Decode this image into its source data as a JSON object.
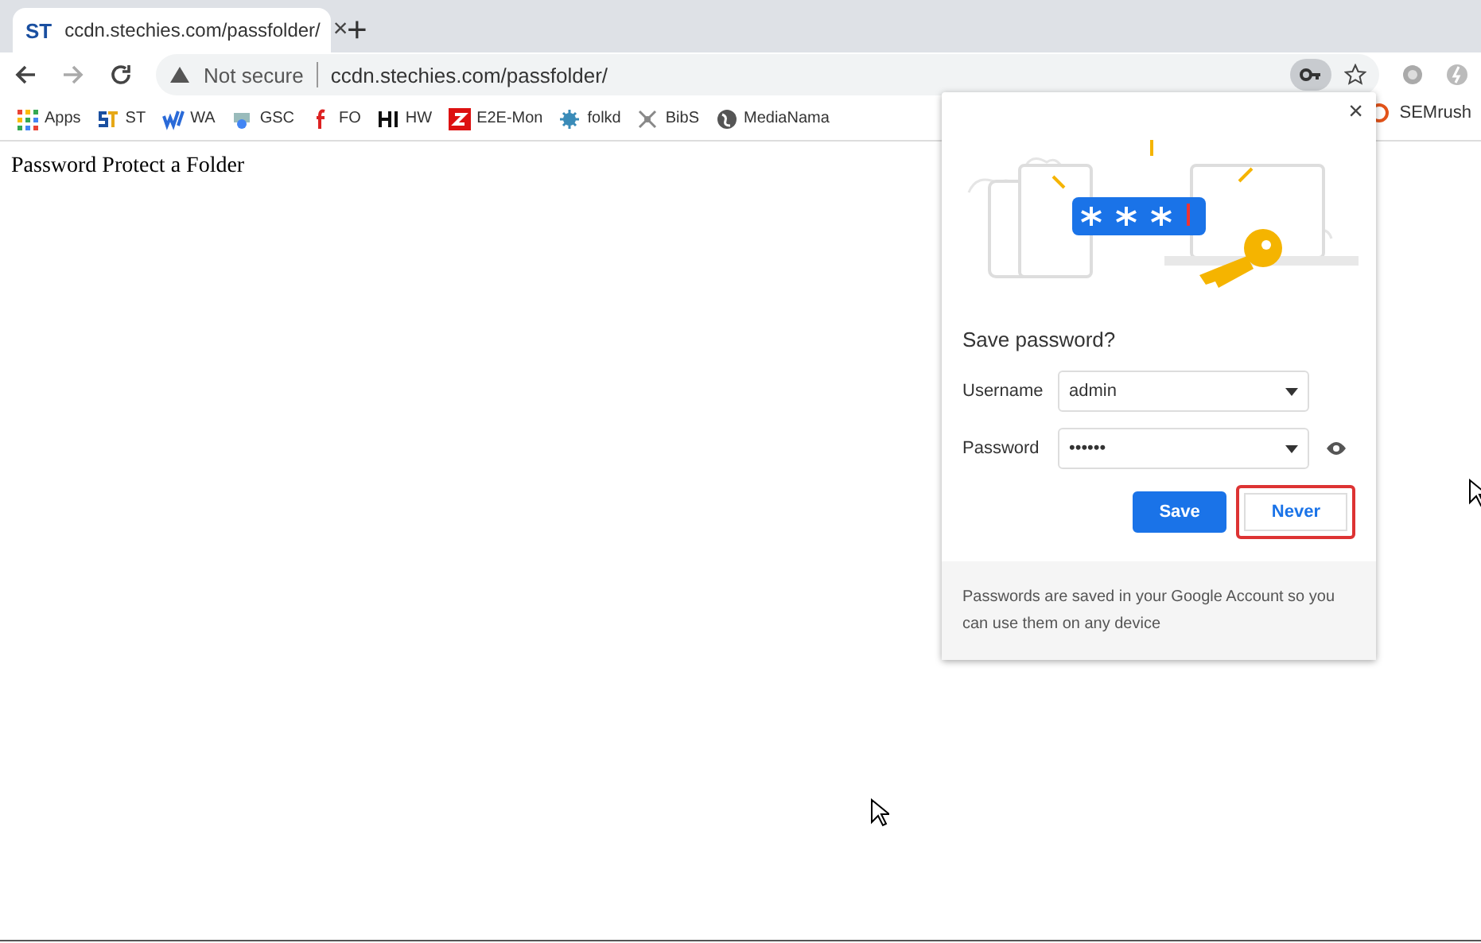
{
  "tab": {
    "favicon": "ST",
    "title": "ccdn.stechies.com/passfolder/",
    "close": "×",
    "new_tab": "+"
  },
  "toolbar": {
    "security": "Not secure",
    "url": "ccdn.stechies.com/passfolder/"
  },
  "bookmarks": [
    {
      "kind": "apps",
      "label": "Apps"
    },
    {
      "kind": "st",
      "label": "ST"
    },
    {
      "kind": "wa",
      "label": "WA"
    },
    {
      "kind": "gsc",
      "label": "GSC"
    },
    {
      "kind": "fo",
      "label": "FO"
    },
    {
      "kind": "hw",
      "label": "HW"
    },
    {
      "kind": "z",
      "label": "E2E-Mon"
    },
    {
      "kind": "gear",
      "label": "folkd"
    },
    {
      "kind": "bibs",
      "label": "BibS"
    },
    {
      "kind": "globe",
      "label": "MediaNama"
    }
  ],
  "bookmark_right": {
    "kind": "ring",
    "label": "SEMrush"
  },
  "page": {
    "text": "Password Protect a Folder"
  },
  "dialog": {
    "title": "Save password?",
    "close": "×",
    "fields": [
      {
        "label": "Username",
        "value": "admin",
        "reveal": false
      },
      {
        "label": "Password",
        "value": "••••••",
        "reveal": true
      }
    ],
    "buttons": [
      {
        "label": "Save",
        "kind": "primary",
        "highlighted": false
      },
      {
        "label": "Never",
        "kind": "secondary",
        "highlighted": true
      }
    ],
    "footer": "Passwords are saved in your Google Account so you can use them on any device"
  }
}
